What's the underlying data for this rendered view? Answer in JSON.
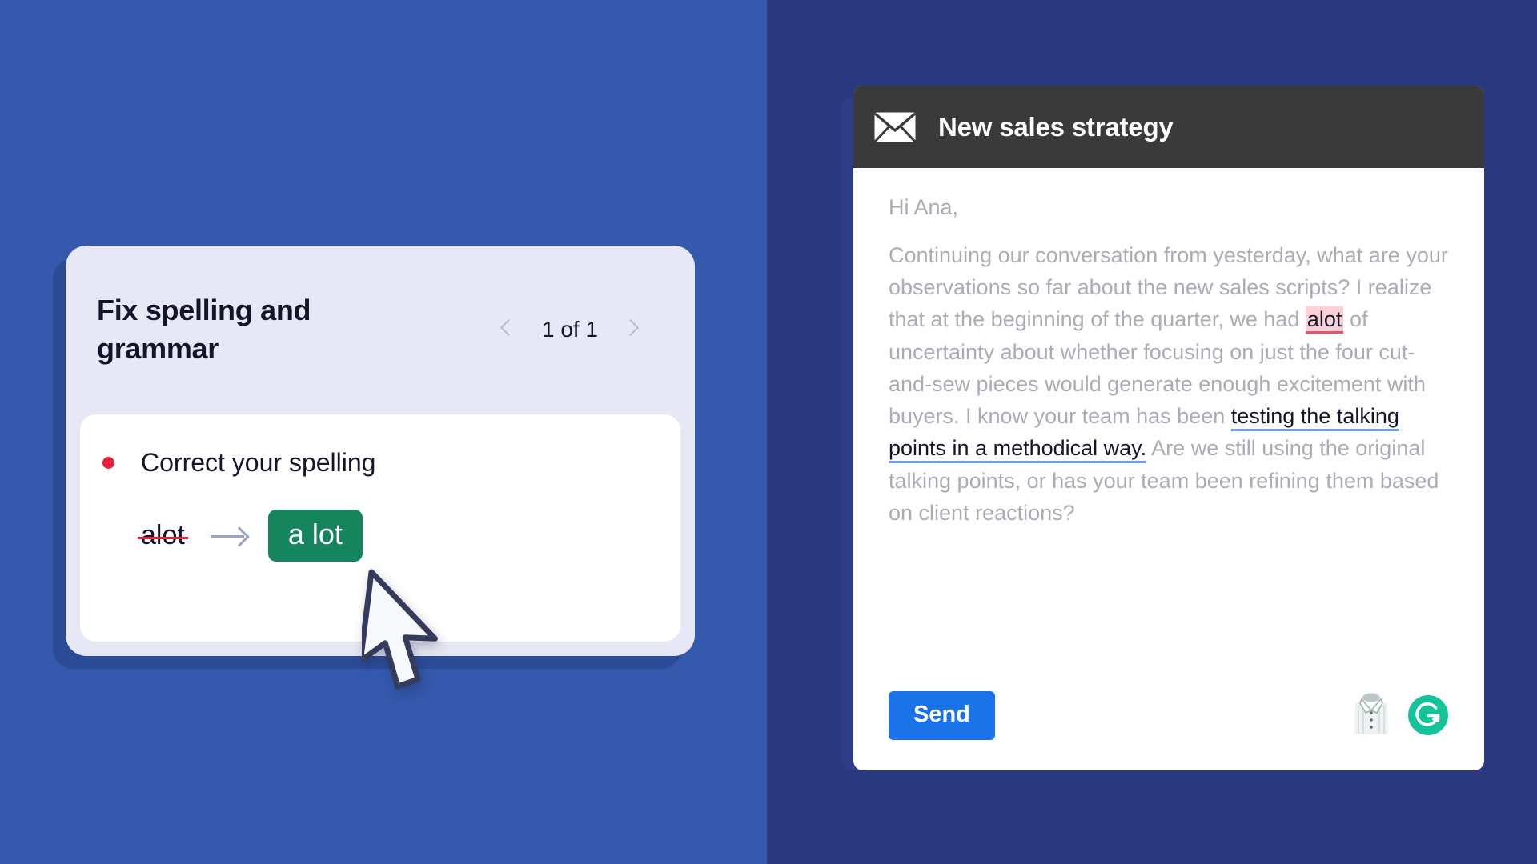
{
  "theme": {
    "left_panel_color": "#3459AD",
    "right_panel_color": "#2A3880",
    "card_surface_color": "#E6E8F5",
    "accent_green": "#15855E",
    "accent_blue": "#1A73E8",
    "error_red": "#E81F39",
    "grammarly_green": "#15C39A",
    "header_dark": "#3A3A3A",
    "body_text_gray": "#A9ACB3",
    "error_highlight_bg": "#FBD0D6",
    "error_underline": "#E8526C",
    "ok_underline": "#6E9BE8"
  },
  "suggestion_card": {
    "title": "Fix spelling and grammar",
    "pager": {
      "prev_icon": "chevron-left-icon",
      "label": "1 of 1",
      "next_icon": "chevron-right-icon"
    },
    "bullet": {
      "dot_icon": "red-dot-icon",
      "text": "Correct your spelling"
    },
    "replacement": {
      "original": "alot",
      "arrow_icon": "arrow-right-icon",
      "suggestion": "a lot"
    }
  },
  "cursor": {
    "icon": "mouse-pointer-icon"
  },
  "email": {
    "header": {
      "icon": "envelope-icon",
      "subject": "New sales strategy"
    },
    "greeting": "Hi Ana,",
    "body": {
      "part1": "Continuing our conversation from yesterday, what are your observations so far about the new sales scripts? I realize that at the beginning of the quarter, we had ",
      "error_word": "alot",
      "part2": " of uncertainty about whether focusing on just the four cut-and-sew pieces would generate enough excitement with buyers. I know your team has been ",
      "highlight_phrase": "testing the talking points in a methodical way.",
      "part3": " Are we still using the original talking points, or has your team been refining them based on client reactions?"
    },
    "footer": {
      "send_label": "Send",
      "shirt_icon": "dress-shirt-icon",
      "grammarly_icon": "grammarly-logo-icon"
    }
  }
}
